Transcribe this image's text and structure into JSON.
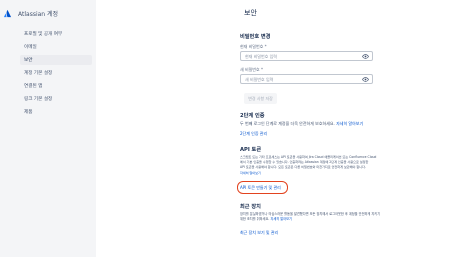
{
  "sidebar": {
    "brand": "Atlassian 계정",
    "items": [
      {
        "label": "프로필 및 공개 여부"
      },
      {
        "label": "이메일"
      },
      {
        "label": "보안",
        "active": true
      },
      {
        "label": "계정 기본 설정"
      },
      {
        "label": "연결된 앱"
      },
      {
        "label": "링크 기본 설정"
      },
      {
        "label": "제품"
      }
    ]
  },
  "main": {
    "title": "보안",
    "password": {
      "heading": "비밀번호 변경",
      "current_label": "현재 비밀번호 *",
      "current_placeholder": "현재 비밀번호 입력",
      "new_label": "새 비밀번호 *",
      "new_placeholder": "새 비밀번호 입력",
      "save_button": "변경 사항 저장"
    },
    "two_step": {
      "heading": "2단계 인증",
      "desc_before": "두 번째 로그인 단계로 계정을 더욱 안전하게 보호하세요.",
      "desc_link": "자세히 알아보기",
      "link": "2단계 인증 관리"
    },
    "api": {
      "heading": "API 토큰",
      "desc_lines": [
        "스크립트 또는 기타 프로세스는 API 토큰을 사용하여 Jira Cloud 애플리케이션 또는 Confluence Cloud",
        "에서 기본 인증을 수행할 수 있습니다. 인증하려는 Atlassian 계정에 2단계 인증을 사용으로 설정한",
        "API 토큰을 사용해야 합니다. 모든 토큰은 다른 비밀번호와 마찬가지로 안전하게 보관해야 합니다."
      ],
      "desc_link": "자세히 알아보기",
      "link": "API 토큰 만들기 및 관리"
    },
    "devices": {
      "heading": "최근 장치",
      "desc_lines": [
        "장치를 분실하였거나 의심스러운 활동을 발견했다면 모든 장치에서 로그아웃한 후 계정을 안전하게 지키기",
        "위한 조치를 취하세요."
      ],
      "desc_link": "자세히 알아보기",
      "link": "최근 장치 보기 및 관리"
    }
  },
  "colors": {
    "sidebar_bg": "#f4f5f7",
    "link": "#0052cc",
    "highlight": "#e2431f",
    "text": "#172b4d"
  },
  "icons": {
    "brand": "atlassian-logo-icon",
    "password_toggle": "eye-icon"
  }
}
